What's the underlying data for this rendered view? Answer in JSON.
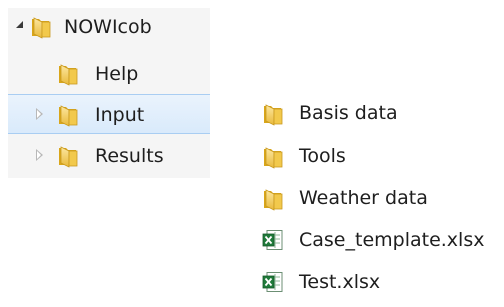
{
  "tree": {
    "root": {
      "label": "NOWIcob",
      "expanded": true,
      "icon": "folder-icon"
    },
    "children": [
      {
        "label": "Help",
        "icon": "folder-icon",
        "has_children": false,
        "selected": false
      },
      {
        "label": "Input",
        "icon": "folder-icon",
        "has_children": true,
        "selected": true
      },
      {
        "label": "Results",
        "icon": "folder-icon",
        "has_children": true,
        "selected": false
      }
    ]
  },
  "file_list": {
    "items": [
      {
        "label": "Basis data",
        "icon": "folder-icon"
      },
      {
        "label": "Tools",
        "icon": "folder-icon"
      },
      {
        "label": "Weather data",
        "icon": "folder-icon"
      },
      {
        "label": "Case_template.xlsx",
        "icon": "excel-file-icon"
      },
      {
        "label": "Test.xlsx",
        "icon": "excel-file-icon"
      }
    ]
  },
  "colors": {
    "folder_body": "#f2c94c",
    "folder_shade": "#d9a61a",
    "selection_fill": "#d9eafb",
    "selection_border": "#a9cdf2",
    "excel_green": "#1f7a3a",
    "panel_bg": "#f5f5f5"
  }
}
